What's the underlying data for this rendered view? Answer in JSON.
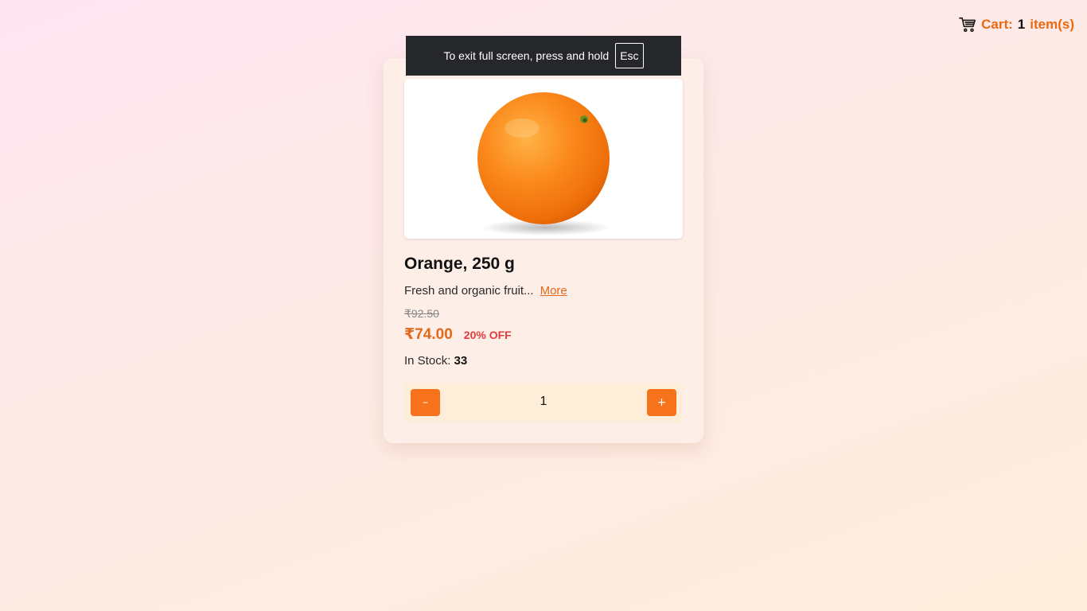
{
  "cart": {
    "label": "Cart:",
    "count": "1",
    "suffix": "item(s)",
    "icon": "shopping-cart-icon"
  },
  "fullscreen_notice": {
    "text": "To exit full screen, press and hold",
    "key": "Esc"
  },
  "product": {
    "image_icon": "orange-fruit-image",
    "title": "Orange, 250 g",
    "description": "Fresh and organic fruit...",
    "more_link": "More",
    "original_price": "₹92.50",
    "price": "₹74.00",
    "discount": "20% OFF",
    "stock_label": "In Stock:",
    "stock_count": "33"
  },
  "quantity": {
    "minus_label": "–",
    "value": "1",
    "plus_label": "+"
  },
  "colors": {
    "accent": "#f7731b",
    "price": "#e2691b",
    "discount": "#e23b3b",
    "banner": "#25272b"
  }
}
